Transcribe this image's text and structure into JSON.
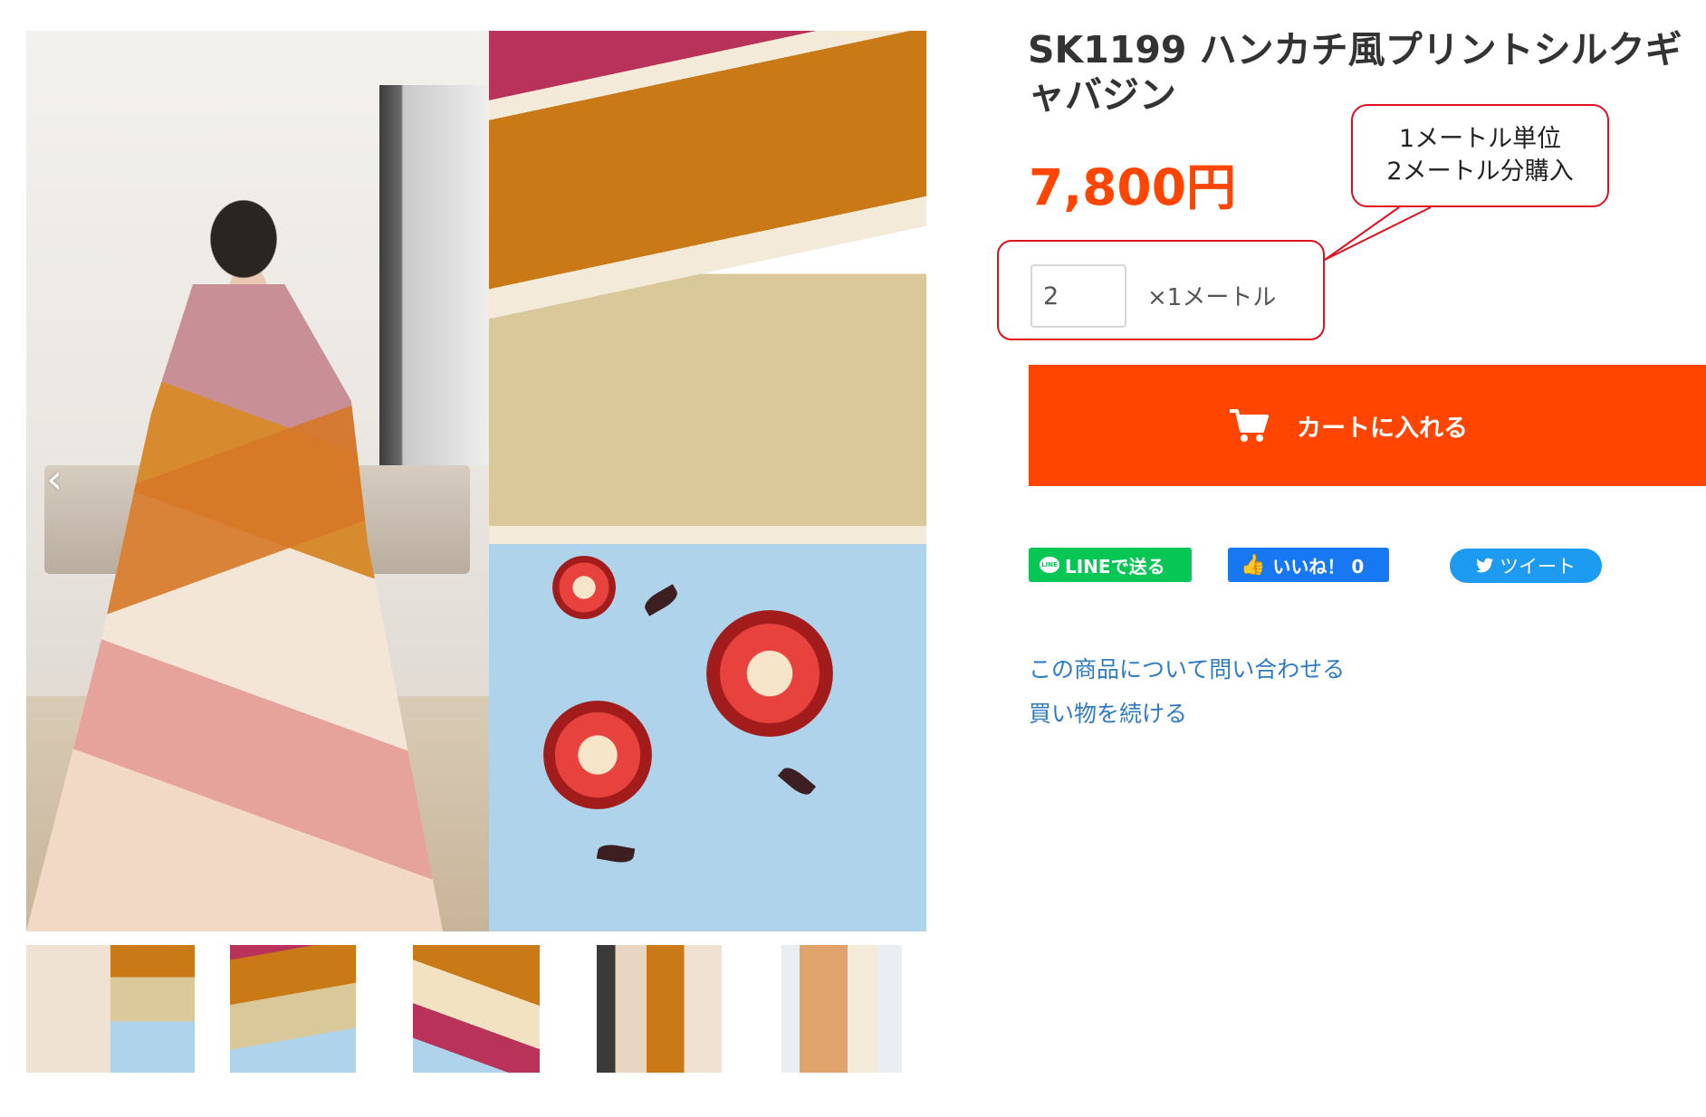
{
  "product": {
    "title": "SK1199 ハンカチ風プリントシルクギャバジン",
    "price": "7,800円"
  },
  "quantity": {
    "value": "2",
    "unit_label": "×1メートル"
  },
  "cart": {
    "button_label": "カートに入れる",
    "icon": "cart-icon"
  },
  "gallery": {
    "prev_arrow": "‹",
    "thumbnail_count": 5
  },
  "social": {
    "line_label": "LINEで送る",
    "line_icon_text": "LINE",
    "facebook_label": "いいね！ 0",
    "twitter_label": "ツイート"
  },
  "links": {
    "inquiry": "この商品について問い合わせる",
    "continue_shopping": "買い物を続ける"
  },
  "annotation": {
    "line1": "1メートル単位",
    "line2": "2メートル分購入",
    "border_color": "#e0101e"
  },
  "colors": {
    "accent": "#ff4500",
    "link": "#2e7bc4",
    "line": "#06c755",
    "facebook": "#1877f2",
    "twitter": "#1d9bf0"
  }
}
